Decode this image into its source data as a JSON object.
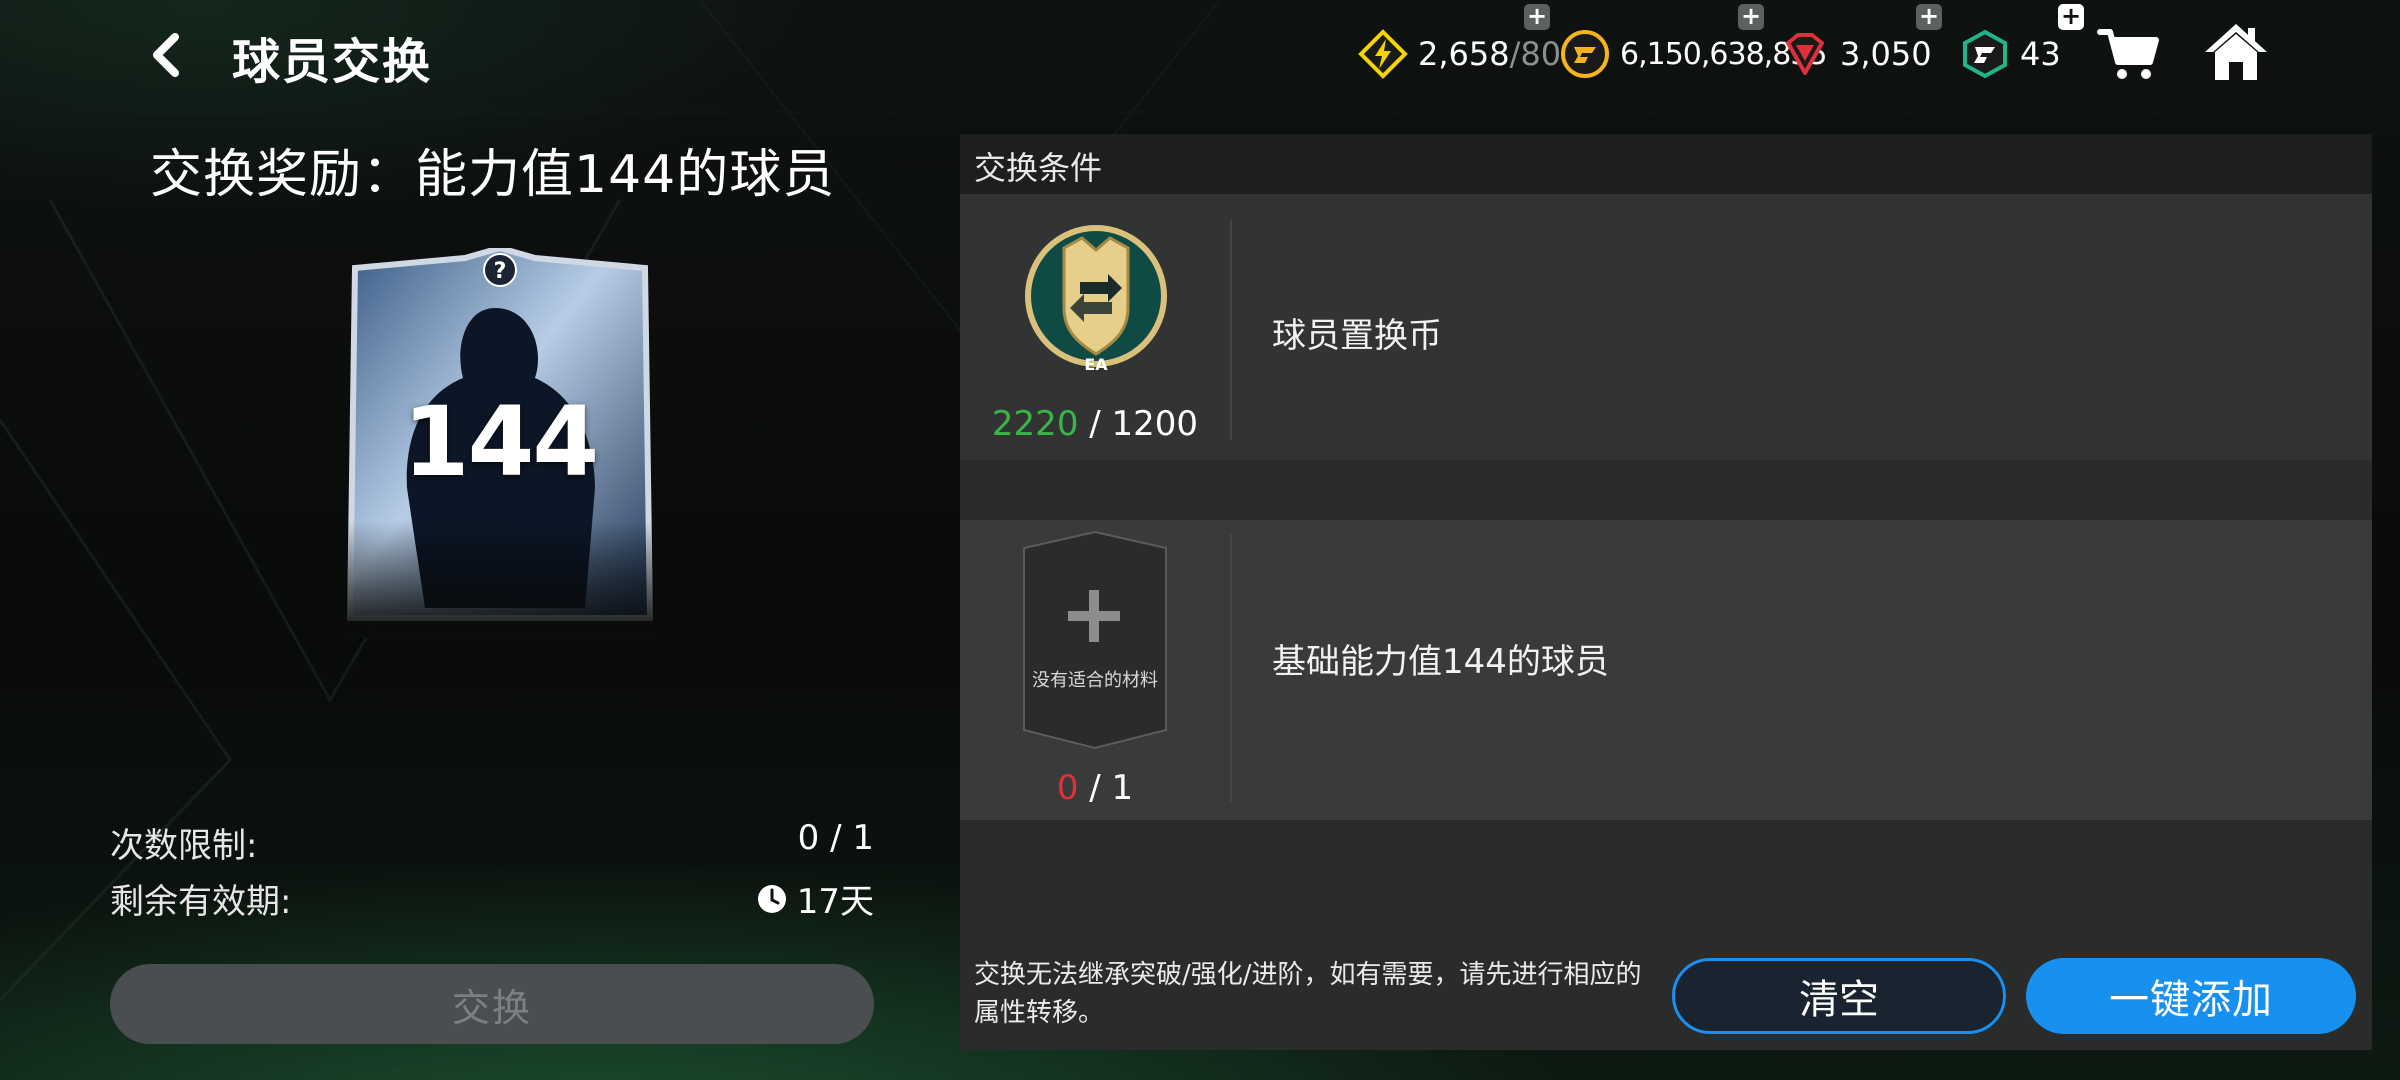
{
  "header": {
    "title": "球员交换",
    "currencies": [
      {
        "icon": "energy-icon",
        "value": "2,658",
        "max": "/80",
        "color": "#f5d500"
      },
      {
        "icon": "coin-icon",
        "value": "6,150,638,855",
        "color": "#f3b51b"
      },
      {
        "icon": "gem-icon",
        "value": "3,050",
        "color": "#e0303a"
      },
      {
        "icon": "fc-point-icon",
        "value": "43",
        "color": "#1fb58a"
      }
    ]
  },
  "reward": {
    "title": "交换奖励：能力值144的球员",
    "card_rating": "144"
  },
  "limits": {
    "count_label": "次数限制:",
    "count_value": "0 / 1",
    "validity_label": "剩余有效期:",
    "validity_value": "17天"
  },
  "exchange_button": "交换",
  "conditions": {
    "header": "交换条件",
    "items": [
      {
        "name": "球员置换币",
        "have": "2220",
        "need": "/ 1200"
      },
      {
        "name": "基础能力值144的球员",
        "have": "0",
        "need": "/ 1",
        "slot_text": "没有适合的材料"
      }
    ],
    "note": "交换无法继承突破/强化/进阶，如有需要，请先进行相应的属性转移。",
    "clear_button": "清空",
    "add_button": "一键添加"
  },
  "colors": {
    "accent": "#1890f0",
    "ok": "#3bb54a",
    "insufficient": "#e0303a"
  }
}
